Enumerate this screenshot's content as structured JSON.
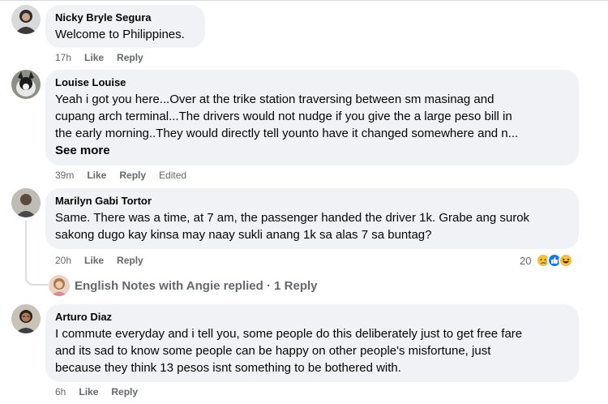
{
  "colors": {
    "bubble_bg": "#f0f2f5",
    "meta_text": "#65676b",
    "name_text": "#050505"
  },
  "comments": [
    {
      "author": "Nicky Bryle Segura",
      "text": "Welcome to Philippines.",
      "time": "17h",
      "like_label": "Like",
      "reply_label": "Reply",
      "avatar_icon": "profile-photo"
    },
    {
      "author": "Louise Louise",
      "lines": [
        "Yeah i got you here...Over at the trike station traversing between sm masinag and",
        "cupang arch terminal...The drivers would not nudge if you give the a large peso bill in",
        "the early morning..They would directly tell younto have it changed somewhere and n..."
      ],
      "see_more": "See more",
      "time": "39m",
      "like_label": "Like",
      "reply_label": "Reply",
      "edited_label": "Edited",
      "avatar_icon": "profile-photo"
    },
    {
      "author": "Marilyn Gabi Tortor",
      "lines": [
        "Same. There was a time, at 7 am, the passenger handed the driver 1k. Grabe ang surok",
        "sakong dugo kay kinsa may naay sukli anang 1k sa alas 7 sa buntag?"
      ],
      "time": "20h",
      "like_label": "Like",
      "reply_label": "Reply",
      "reaction_count": "20",
      "reaction_icons": [
        "sad-reaction-icon",
        "like-reaction-icon",
        "haha-reaction-icon"
      ],
      "replied_text": "English Notes with Angie replied · 1 Reply",
      "avatar_icon": "profile-photo"
    },
    {
      "author": "Arturo Diaz",
      "lines": [
        "I commute everyday and i tell you, some people do this deliberately just to get free fare",
        "and its sad to know some people can be happy on other people's misfortune, just",
        "because they think 13 pesos isnt something to be bothered with."
      ],
      "time": "6h",
      "like_label": "Like",
      "reply_label": "Reply",
      "avatar_icon": "profile-photo"
    }
  ]
}
